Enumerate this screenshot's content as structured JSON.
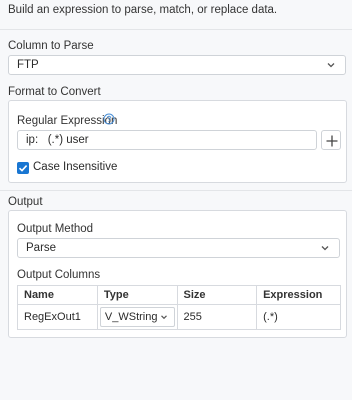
{
  "description": "Build an expression to parse, match, or replace data.",
  "column_to_parse": {
    "label": "Column to Parse",
    "value": "FTP"
  },
  "format_to_convert": {
    "label": "Format to Convert",
    "regex_label": "Regular Expression",
    "regex_value": "ip:   (.*) user",
    "case_insensitive_label": "Case Insensitive",
    "case_insensitive_checked": true
  },
  "output": {
    "label": "Output",
    "method_label": "Output Method",
    "method_value": "Parse",
    "columns_label": "Output Columns",
    "columns": {
      "headers": [
        "Name",
        "Type",
        "Size",
        "Expression"
      ],
      "rows": [
        {
          "name": "RegExOut1",
          "type": "V_WString",
          "size": "255",
          "expression": "(.*)"
        }
      ]
    }
  },
  "colors": {
    "accent": "#1976d2",
    "border": "#cfd3d8"
  },
  "icons": {
    "chevron": "chevron-down-icon",
    "help": "help-circle-icon",
    "plus": "plus-icon",
    "check": "check-icon"
  }
}
